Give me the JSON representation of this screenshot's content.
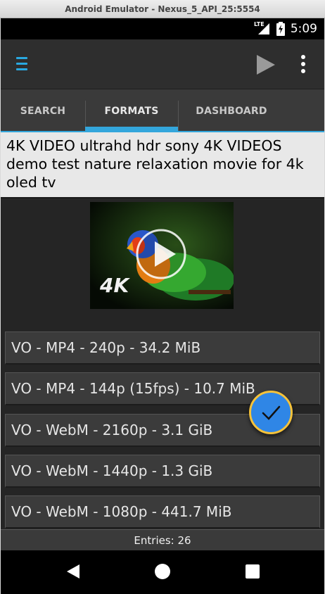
{
  "window": {
    "title": "Android Emulator - Nexus_5_API_25:5554"
  },
  "status_bar": {
    "network": "LTE",
    "time": "5:09"
  },
  "toolbar": {
    "menu_icon": "hamburger-menu-icon",
    "play_icon": "play-icon",
    "overflow_icon": "more-vert-icon"
  },
  "tabs": [
    {
      "label": "SEARCH",
      "active": false
    },
    {
      "label": "FORMATS",
      "active": true
    },
    {
      "label": "DASHBOARD",
      "active": false
    }
  ],
  "video": {
    "title": "4K VIDEO ultrahd hdr sony 4K VIDEOS demo test nature relaxation movie for 4k oled tv",
    "thumbnail_badge": "4K"
  },
  "formats": [
    "VO - MP4 - 240p - 34.2 MiB",
    "VO - MP4 - 144p (15fps) - 10.7 MiB",
    "VO - WebM - 2160p - 3.1 GiB",
    "VO - WebM - 1440p - 1.3 GiB",
    "VO - WebM - 1080p - 441.7 MiB"
  ],
  "fab": {
    "icon": "check-icon"
  },
  "footer": {
    "entries": "Entries: 26"
  },
  "nav": {
    "back": "back-icon",
    "home": "home-icon",
    "recents": "recents-icon"
  },
  "colors": {
    "accent": "#33a6dc",
    "fab": "#2f86e6",
    "fab_ring": "#f5c23a"
  }
}
